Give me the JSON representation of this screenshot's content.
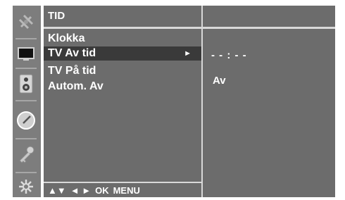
{
  "menu": {
    "title": "TID",
    "items": [
      {
        "label": "Klokka",
        "selected": false
      },
      {
        "label": "TV Av tid",
        "selected": true
      },
      {
        "label": "TV På tid",
        "selected": false
      },
      {
        "label": "Autom. Av",
        "selected": false
      }
    ],
    "selected_arrow": "►",
    "nav_hint": {
      "updown": "▲▼",
      "leftright": "◄ ►",
      "ok": "OK",
      "menu": "MENU"
    }
  },
  "right_panel": {
    "time_value": "- - : - -",
    "option_value": "Av"
  },
  "iconbar": {
    "icons": [
      "antenna-icon",
      "picture-icon",
      "speaker-icon",
      "clock-icon",
      "key-icon",
      "network-icon"
    ]
  },
  "colors": {
    "panel": "#6c6c6c",
    "iconbar": "#7d7d7d",
    "selected_row": "#3a3a3a",
    "text": "#ffffff",
    "divider": "#d9d9d9"
  }
}
